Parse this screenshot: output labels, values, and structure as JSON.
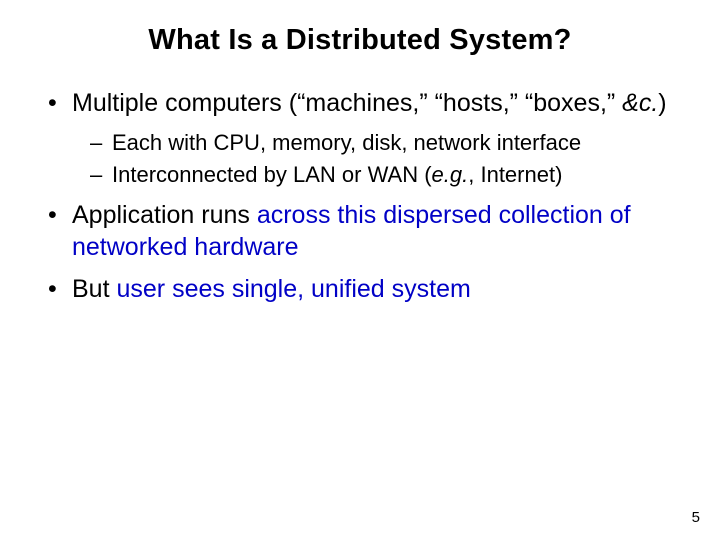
{
  "title": "What Is a Distributed System?",
  "bullets": {
    "b1_pre": "Multiple computers (“machines,” “hosts,” “boxes,” ",
    "b1_it": "&c.",
    "b1_post": ")",
    "b1s1": "Each with CPU, memory, disk, network interface",
    "b1s2_pre": "Interconnected by LAN or WAN (",
    "b1s2_it": "e.g.",
    "b1s2_post": ", Internet)",
    "b2_plain": "Application runs ",
    "b2_blue": "across this dispersed collection of networked hardware",
    "b3_plain": "But ",
    "b3_blue": "user sees single, unified system"
  },
  "page_number": "5"
}
